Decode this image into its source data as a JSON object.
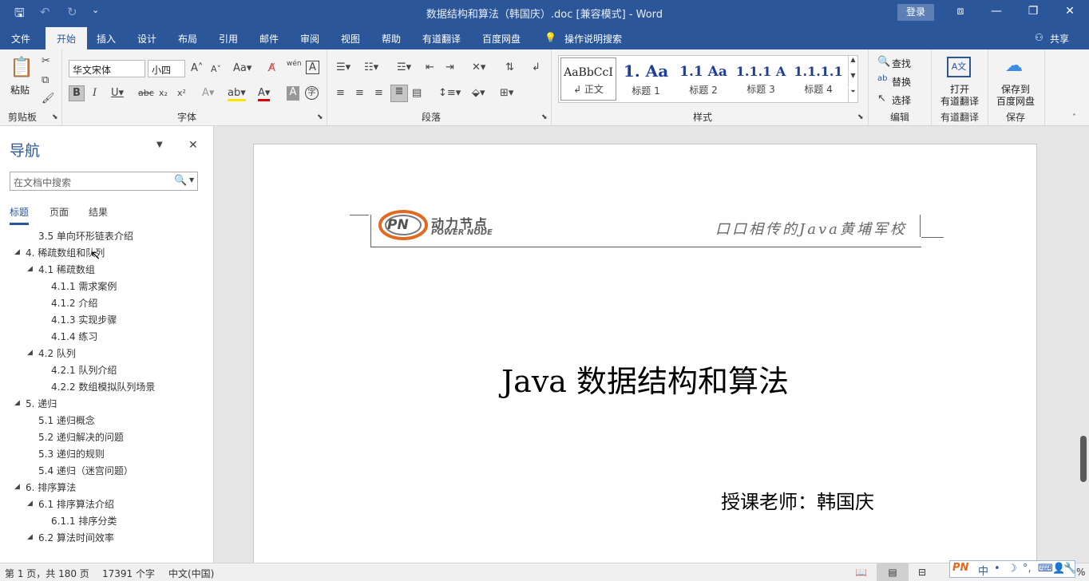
{
  "window": {
    "title": "数据结构和算法（韩国庆）.doc [兼容模式] - Word",
    "login_label": "登录",
    "share_label": "共享",
    "quick_access": [
      "save-icon",
      "undo-icon",
      "redo-icon",
      "customize-icon"
    ]
  },
  "menu": {
    "items": [
      "文件",
      "开始",
      "插入",
      "设计",
      "布局",
      "引用",
      "邮件",
      "审阅",
      "视图",
      "帮助",
      "有道翻译",
      "百度网盘"
    ],
    "active": "开始",
    "tell_me": "操作说明搜索"
  },
  "ribbon": {
    "clipboard": {
      "paste": "粘贴",
      "label": "剪贴板"
    },
    "font": {
      "name": "华文宋体",
      "size": "小四",
      "label": "字体",
      "pinyin": "wén"
    },
    "paragraph": {
      "label": "段落"
    },
    "styles": {
      "label": "样式",
      "items": [
        {
          "sample": "AaBbCcI",
          "name": "↲ 正文"
        },
        {
          "sample": "1. Aa",
          "name": "标题 1"
        },
        {
          "sample": "1.1 Aa",
          "name": "标题 2"
        },
        {
          "sample": "1.1.1 A",
          "name": "标题 3"
        },
        {
          "sample": "1.1.1.1",
          "name": "标题 4"
        }
      ]
    },
    "editing": {
      "find": "查找",
      "replace": "替换",
      "select": "选择",
      "label": "编辑"
    },
    "youdao": {
      "open_line1": "打开",
      "open_line2": "有道翻译",
      "label": "有道翻译"
    },
    "baidu": {
      "save_line1": "保存到",
      "save_line2": "百度网盘",
      "label": "保存"
    }
  },
  "navigation": {
    "title": "导航",
    "search_placeholder": "在文档中搜索",
    "tabs": [
      "标题",
      "页面",
      "结果"
    ],
    "active_tab": "标题",
    "tree": [
      {
        "text": "3.5 单向环形链表介绍",
        "level": 2,
        "expand": false
      },
      {
        "text": "4. 稀疏数组和队列",
        "level": 1,
        "expand": true
      },
      {
        "text": "4.1 稀疏数组",
        "level": 2,
        "expand": true
      },
      {
        "text": "4.1.1 需求案例",
        "level": 3,
        "expand": false
      },
      {
        "text": "4.1.2 介绍",
        "level": 3,
        "expand": false
      },
      {
        "text": "4.1.3 实现步骤",
        "level": 3,
        "expand": false
      },
      {
        "text": "4.1.4 练习",
        "level": 3,
        "expand": false
      },
      {
        "text": "4.2 队列",
        "level": 2,
        "expand": true
      },
      {
        "text": "4.2.1 队列介绍",
        "level": 3,
        "expand": false
      },
      {
        "text": "4.2.2 数组模拟队列场景",
        "level": 3,
        "expand": false
      },
      {
        "text": "5. 递归",
        "level": 1,
        "expand": true
      },
      {
        "text": "5.1 递归概念",
        "level": 2,
        "expand": false
      },
      {
        "text": "5.2 递归解决的问题",
        "level": 2,
        "expand": false
      },
      {
        "text": "5.3 递归的规则",
        "level": 2,
        "expand": false
      },
      {
        "text": "5.4 递归（迷宫问题）",
        "level": 2,
        "expand": false
      },
      {
        "text": "6. 排序算法",
        "level": 1,
        "expand": true
      },
      {
        "text": "6.1 排序算法介绍",
        "level": 2,
        "expand": true
      },
      {
        "text": "6.1.1 排序分类",
        "level": 3,
        "expand": false
      },
      {
        "text": "6.2 算法时间效率",
        "level": 2,
        "expand": true
      }
    ]
  },
  "document": {
    "logo_cn": "动力节点",
    "logo_en": "POWER NODE",
    "logo_mark": "PN",
    "slogan": "口口相传的Java黄埔军校",
    "title": "Java 数据结构和算法",
    "author": "授课老师：韩国庆"
  },
  "status": {
    "page": "第 1 页，共 180 页",
    "words": "17391 个字",
    "language": "中文(中国)",
    "zoom_tail": "%"
  },
  "ime": {
    "lang": "中",
    "items": [
      "•",
      "☽",
      "°,",
      "⌨",
      "👤",
      "🔧"
    ]
  }
}
